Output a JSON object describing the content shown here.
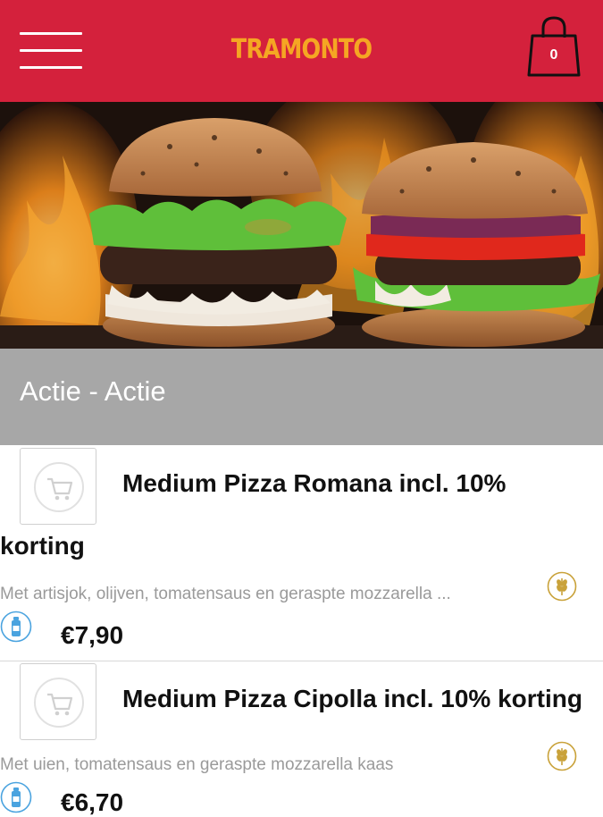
{
  "header": {
    "brand": "TRAMONTO",
    "cart_count": "0",
    "menu_icon": "hamburger-menu-icon",
    "cart_icon": "shopping-bag-icon",
    "background_color": "#d4213c",
    "brand_color": "#f5a623"
  },
  "hero": {
    "image": "two burgers in front of flames"
  },
  "category": {
    "title": "Actie - Actie",
    "background_color": "#a7a7a7"
  },
  "products": [
    {
      "name_line1": "Medium Pizza Romana incl. 10%",
      "name_line2": "korting",
      "description": "Met artisjok, olijven, tomatensaus en geraspte mozzarella ...",
      "price": "€7,90",
      "thumb_icon": "cart-placeholder-icon",
      "allergen_icon": "wheat-icon",
      "drink_icon": "bottle-icon"
    },
    {
      "name_line1": "Medium Pizza Cipolla incl. 10% korting",
      "description": "Met uien, tomatensaus en geraspte mozzarella kaas",
      "price": "€6,70",
      "thumb_icon": "cart-placeholder-icon",
      "allergen_icon": "wheat-icon",
      "drink_icon": "bottle-icon"
    }
  ]
}
